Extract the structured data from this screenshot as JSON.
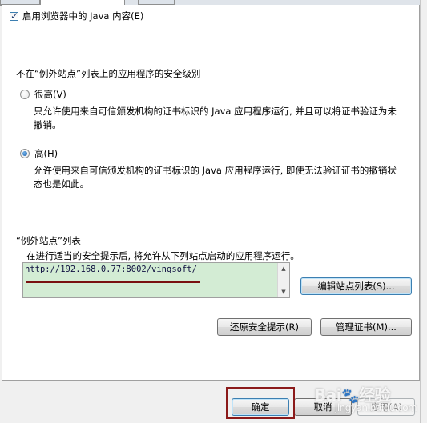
{
  "enable_java": {
    "label": "启用浏览器中的 Java 内容(E)",
    "checked": true
  },
  "security_level": {
    "heading": "不在“例外站点”列表上的应用程序的安全级别",
    "options": [
      {
        "label": "很高(V)",
        "selected": false,
        "description": "只允许使用来自可信颁发机构的证书标识的 Java 应用程序运行, 并且可以将证书验证为未撤销。"
      },
      {
        "label": "高(H)",
        "selected": true,
        "description": "允许使用来自可信颁发机构的证书标识的 Java 应用程序运行, 即使无法验证证书的撤销状态也是如此。"
      }
    ]
  },
  "exception_sites": {
    "title": "“例外站点”列表",
    "hint": "在进行适当的安全提示后, 将允许从下列站点启动的应用程序运行。",
    "entries": [
      "http://192.168.0.77:8002/vingsoft/"
    ],
    "edit_button": "编辑站点列表(S)..."
  },
  "buttons": {
    "restore_prompts": "还原安全提示(R)",
    "manage_certs": "管理证书(M)...",
    "ok": "确定",
    "cancel": "取消",
    "apply": "应用(A)"
  },
  "watermark": {
    "brand": "Bai",
    "brand_tail": "经验",
    "url": "jingyan.baidu.com"
  },
  "colors": {
    "accent": "#3c7fb1",
    "list_bg": "#d3ecd4",
    "annotation": "#8b1a1a"
  }
}
